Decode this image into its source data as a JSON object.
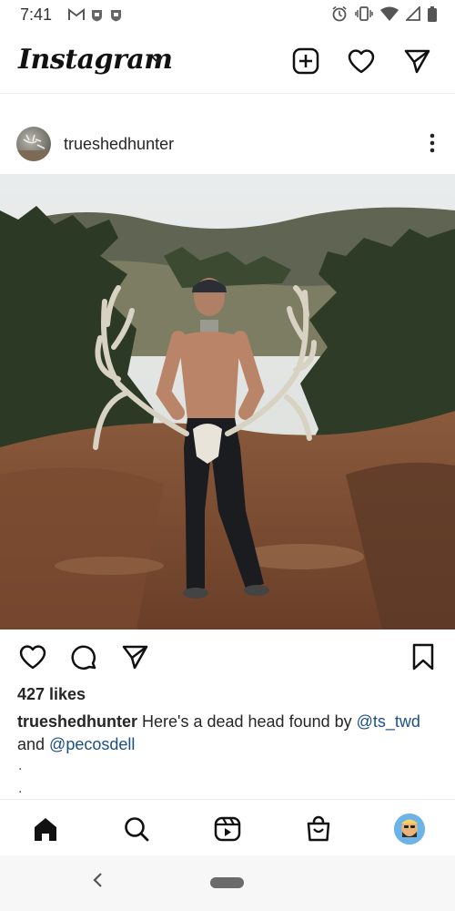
{
  "status_bar": {
    "time": "7:41",
    "left_icons": [
      "gmail-icon",
      "nhl-icon",
      "nhl-icon"
    ],
    "right_icons": [
      "alarm-icon",
      "vibrate-icon",
      "wifi-icon",
      "signal-icon",
      "battery-icon"
    ]
  },
  "header": {
    "logo": "Instagram",
    "icons": [
      "add-post-icon",
      "heart-icon",
      "direct-message-icon"
    ]
  },
  "post": {
    "username": "trueshedhunter",
    "photo_description_icon": "photo",
    "likes": "427 likes",
    "caption": {
      "username": "trueshedhunter",
      "text_before": " Here's a dead head found by ",
      "mention1": "@ts_twd",
      "text_middle": " and ",
      "mention2": "@pecosdell"
    },
    "dots": [
      ".",
      "."
    ]
  },
  "bottom_nav": [
    "home-icon",
    "search-icon",
    "reels-icon",
    "shop-icon",
    "profile-avatar"
  ]
}
